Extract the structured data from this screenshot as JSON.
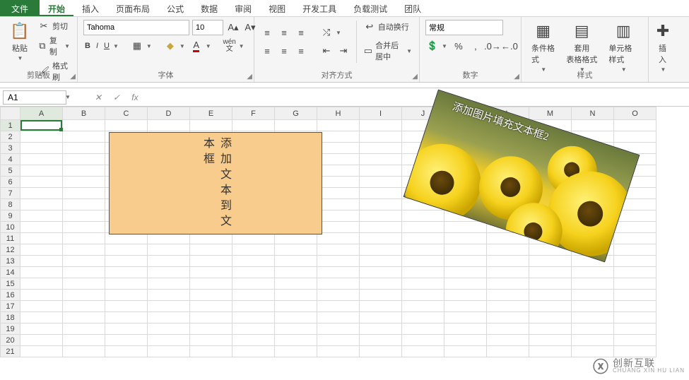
{
  "tabs": {
    "file": "文件",
    "items": [
      "开始",
      "插入",
      "页面布局",
      "公式",
      "数据",
      "审阅",
      "视图",
      "开发工具",
      "负载测试",
      "团队"
    ],
    "active_index": 0
  },
  "ribbon": {
    "clipboard": {
      "paste": "粘贴",
      "cut": "剪切",
      "copy": "复制",
      "format_painter": "格式刷",
      "label": "剪贴板"
    },
    "font": {
      "name": "Tahoma",
      "size": "10",
      "label": "字体",
      "bold": "B",
      "italic": "I",
      "underline": "U",
      "pinyin": "wén 文"
    },
    "align": {
      "wrap": "自动换行",
      "merge": "合并后居中",
      "label": "对齐方式"
    },
    "number": {
      "fmt": "常规",
      "label": "数字"
    },
    "styles": {
      "cond": "条件格式",
      "table": "套用\n表格格式",
      "cell": "单元格样式",
      "label": "样式"
    },
    "insert": {
      "label": "插入"
    }
  },
  "namebox": "A1",
  "grid": {
    "cols": [
      "A",
      "B",
      "C",
      "D",
      "E",
      "F",
      "G",
      "H",
      "I",
      "J",
      "K",
      "L",
      "M",
      "N",
      "O"
    ],
    "rows": 21
  },
  "shapes": {
    "box1_lines": [
      "添",
      "加",
      "文",
      "本",
      "到",
      "文",
      "本",
      "框"
    ],
    "box2_label": "添加图片填充文本框2"
  },
  "watermark": {
    "cn": "创新互联",
    "en": "CHUANG XIN HU LIAN"
  }
}
